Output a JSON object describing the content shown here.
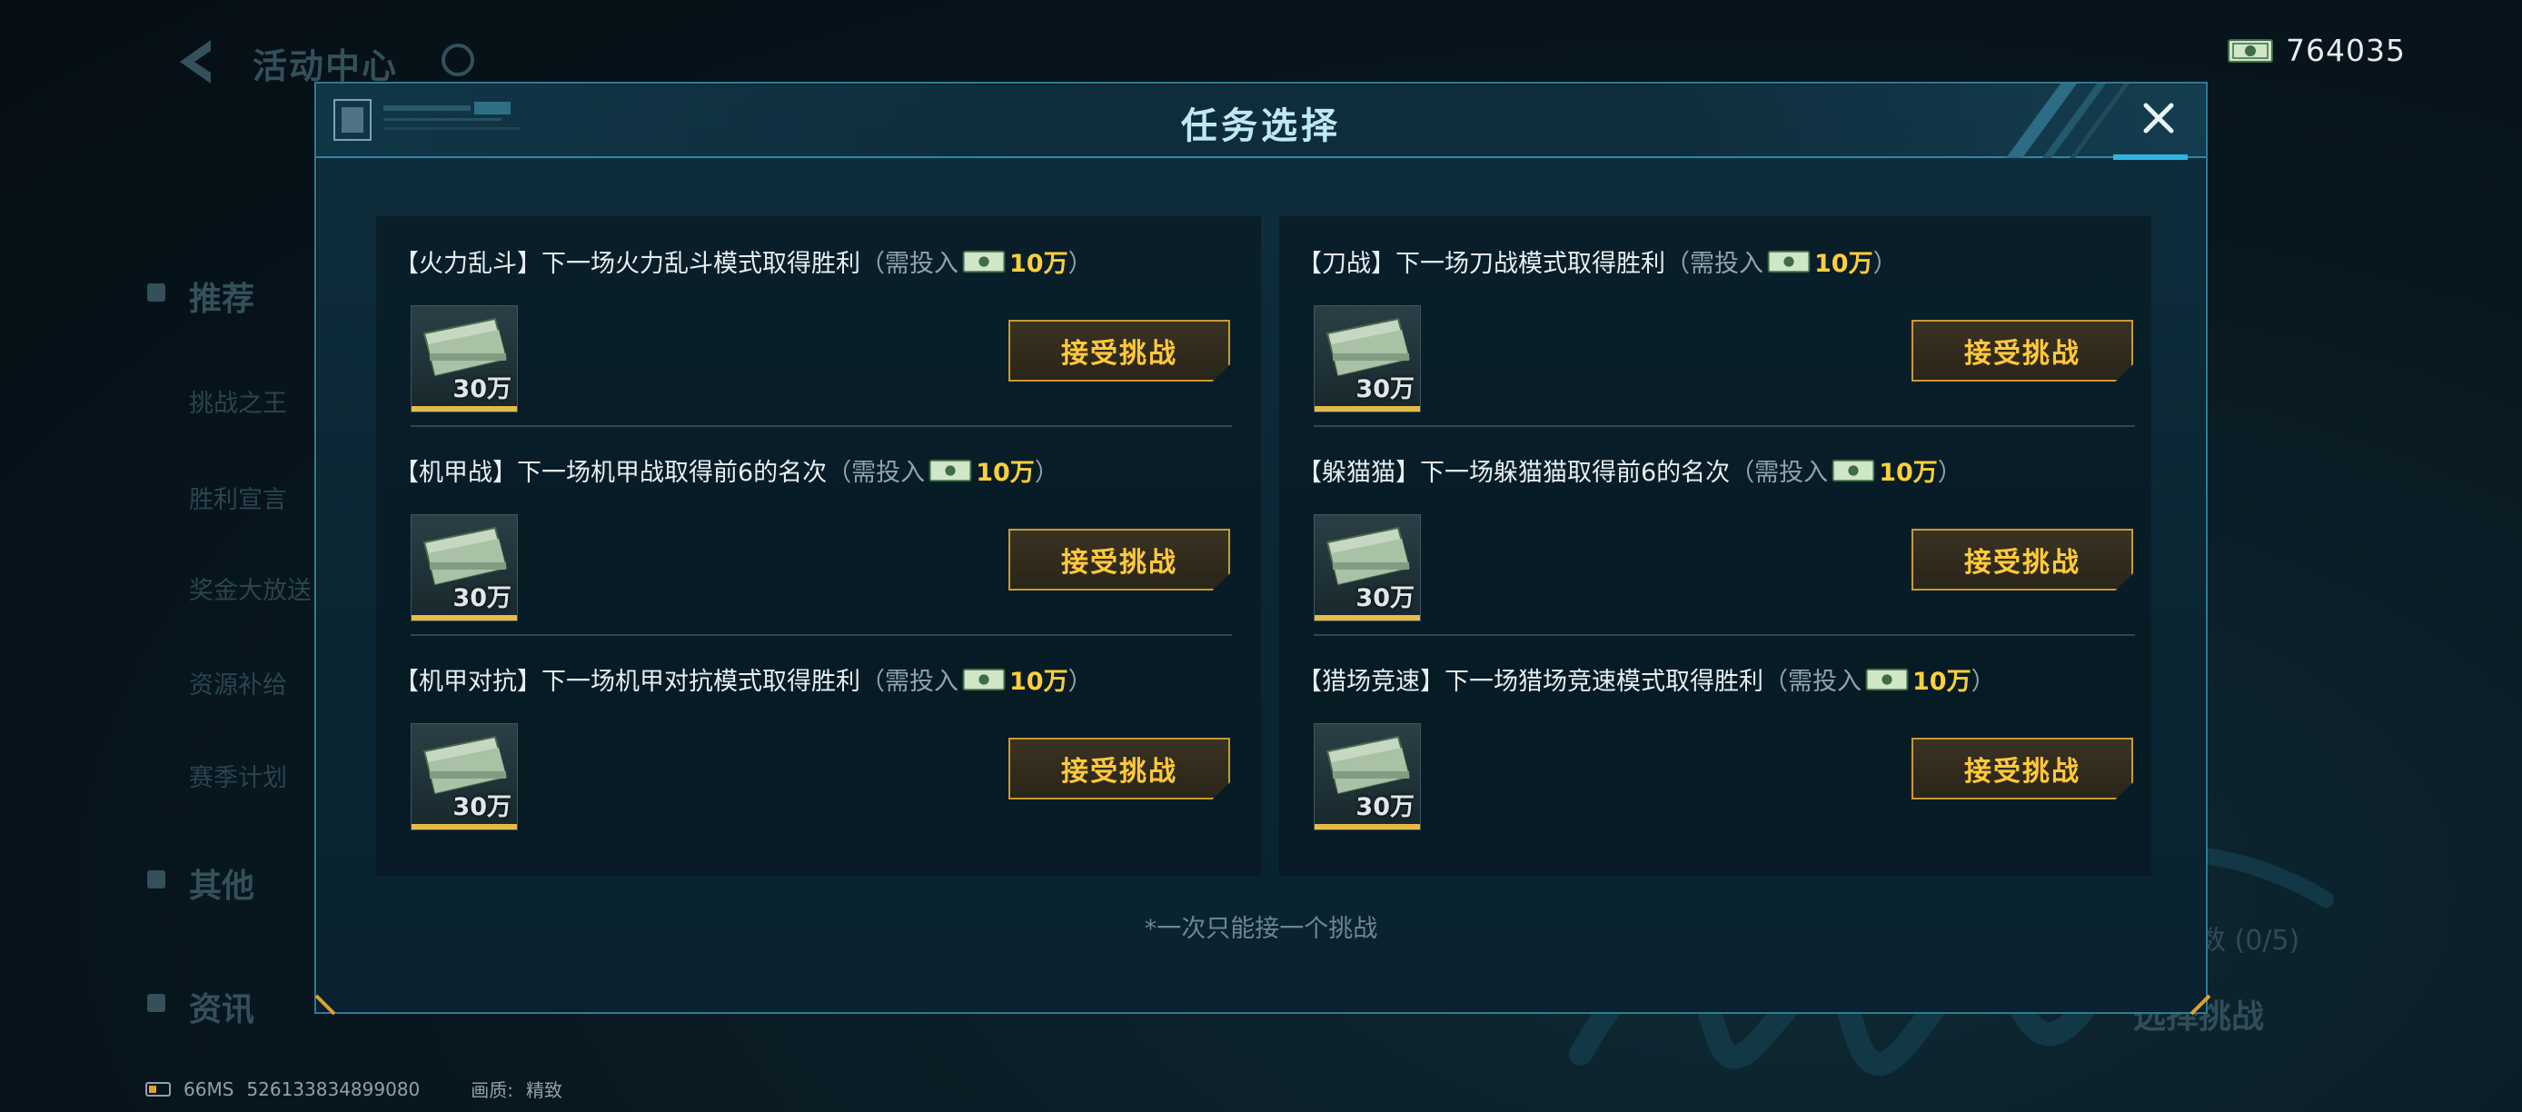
{
  "background": {
    "title": "活动中心",
    "nav": [
      "推荐",
      "其他",
      "资讯"
    ],
    "sub_items": [
      "挑战之王",
      "胜利宣言",
      "奖金大放送",
      "资源补给",
      "赛季计划"
    ],
    "progress_text": "数 (0/5)",
    "goto_label": "选择挑战"
  },
  "currency": {
    "icon": "cash-bill-icon",
    "amount": "764035"
  },
  "modal": {
    "title": "任务选择",
    "close_icon": "close-icon",
    "footnote": "*一次只能接一个挑战",
    "accept_label": "接受挑战",
    "tasks_left": [
      {
        "tag": "【火力乱斗】",
        "desc": "下一场火力乱斗模式取得胜利",
        "cost_prefix": "（需投入",
        "cost": "10万",
        "cost_suffix": "）",
        "reward": "30万"
      },
      {
        "tag": "【机甲战】",
        "desc": "下一场机甲战取得前6的名次",
        "cost_prefix": "（需投入",
        "cost": "10万",
        "cost_suffix": "）",
        "reward": "30万"
      },
      {
        "tag": "【机甲对抗】",
        "desc": "下一场机甲对抗模式取得胜利",
        "cost_prefix": "（需投入",
        "cost": "10万",
        "cost_suffix": "）",
        "reward": "30万"
      }
    ],
    "tasks_right": [
      {
        "tag": "【刀战】",
        "desc": "下一场刀战模式取得胜利",
        "cost_prefix": "（需投入",
        "cost": "10万",
        "cost_suffix": "）",
        "reward": "30万"
      },
      {
        "tag": "【躲猫猫】",
        "desc": "下一场躲猫猫取得前6的名次",
        "cost_prefix": "（需投入",
        "cost": "10万",
        "cost_suffix": "）",
        "reward": "30万"
      },
      {
        "tag": "【猎场竞速】",
        "desc": "下一场猎场竞速模式取得胜利",
        "cost_prefix": "（需投入",
        "cost": "10万",
        "cost_suffix": "）",
        "reward": "30万"
      }
    ]
  },
  "status": {
    "ping": "66MS",
    "uid": "526133834899080",
    "quality_label": "画质:",
    "quality_value": "精致"
  },
  "colors": {
    "accent_cyan": "#2fb6e0",
    "gold": "#ffc93a",
    "cost_yellow": "#ffcf3a"
  }
}
